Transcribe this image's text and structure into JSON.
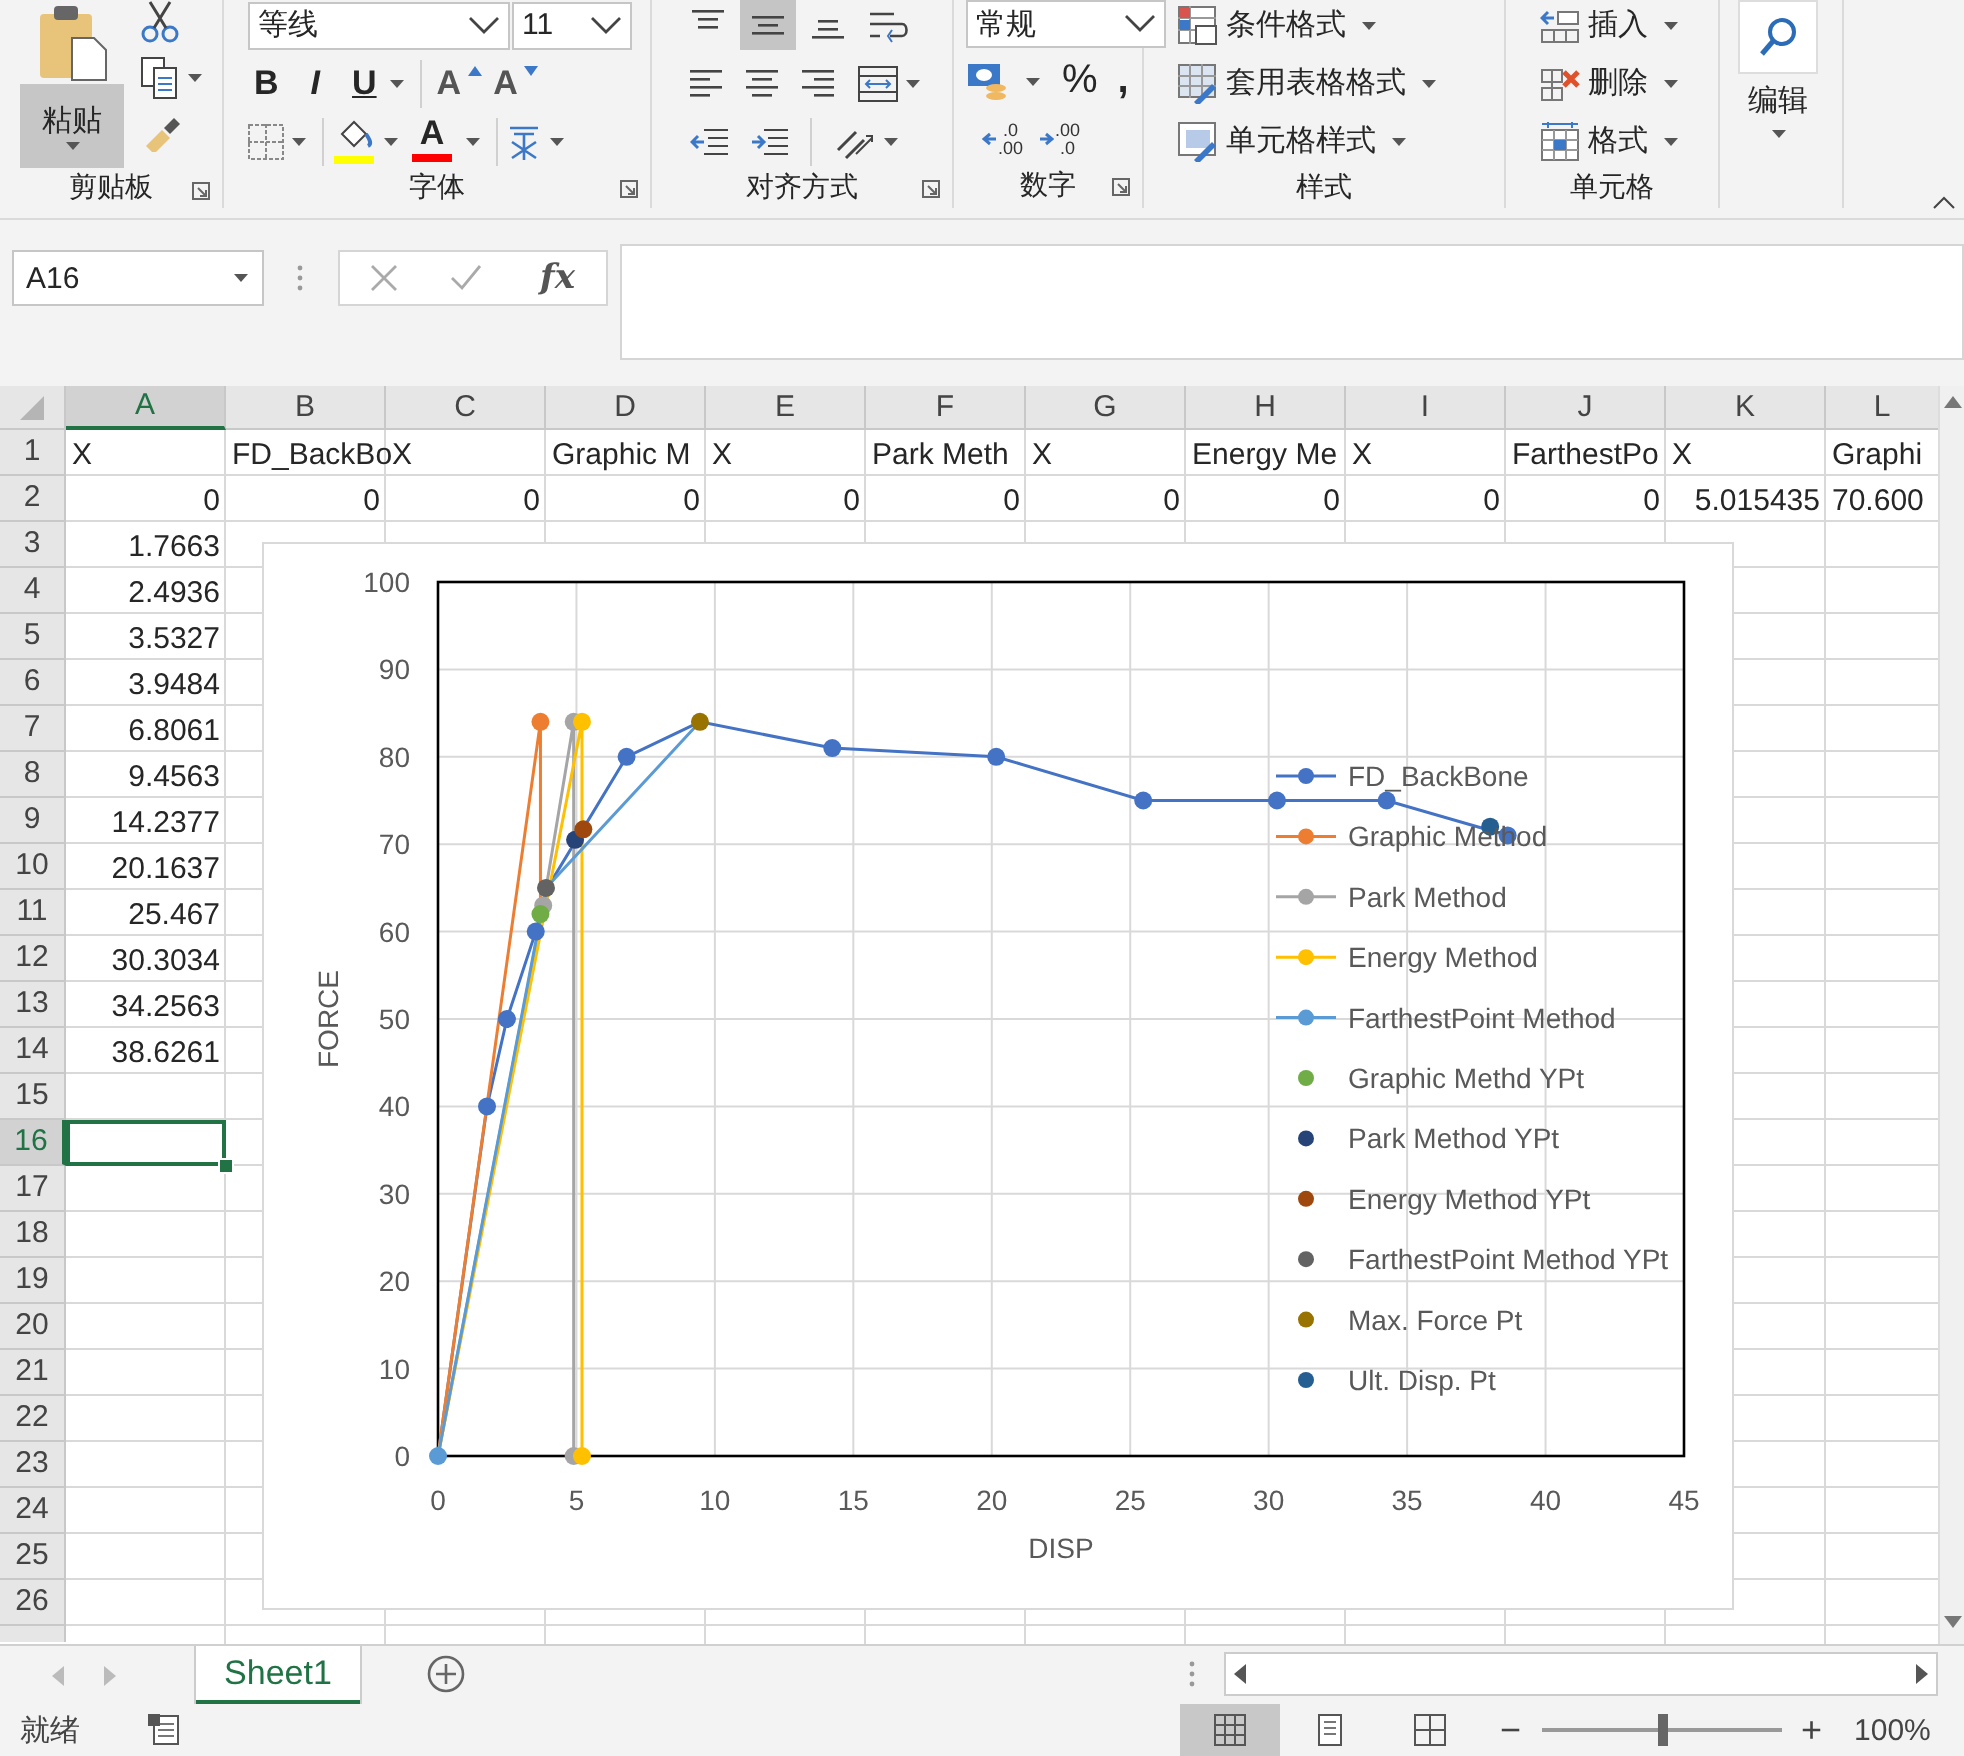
{
  "ribbon": {
    "groups": [
      {
        "kind": "clipboard",
        "label": "剪贴板",
        "launcher": true,
        "paste": "粘贴"
      },
      {
        "kind": "font",
        "label": "字体",
        "launcher": true,
        "family": "等线",
        "size": "11",
        "bold": "B",
        "italic": "I",
        "underline": "U",
        "grow": "A",
        "shrink": "A",
        "font_color": "A"
      },
      {
        "kind": "alignment",
        "label": "对齐方式",
        "launcher": true,
        "vertical": [
          {
            "kind": "top",
            "selected": false
          },
          {
            "kind": "middle",
            "selected": true
          },
          {
            "kind": "bottom",
            "selected": false
          }
        ]
      },
      {
        "kind": "number",
        "label": "数字",
        "launcher": true,
        "format": "常规",
        "percent": "%",
        "comma": ",",
        "decimals": [
          {
            "top": ".0",
            "bottom": ".00"
          },
          {
            "top": ".00",
            "bottom": ".0"
          }
        ]
      },
      {
        "kind": "styles",
        "label": "样式",
        "items": [
          "条件格式",
          "套用表格格式",
          "单元格样式"
        ]
      },
      {
        "kind": "cells",
        "label": "单元格",
        "items": [
          "插入",
          "删除",
          "格式"
        ]
      },
      {
        "kind": "editing",
        "label": "编辑"
      }
    ]
  },
  "formula_bar": {
    "name_box": "A16",
    "fx": "fx"
  },
  "sheet": {
    "columns": [
      {
        "label": "A",
        "selected": true
      },
      {
        "label": "B",
        "selected": false
      },
      {
        "label": "C",
        "selected": false
      },
      {
        "label": "D",
        "selected": false
      },
      {
        "label": "E",
        "selected": false
      },
      {
        "label": "F",
        "selected": false
      },
      {
        "label": "G",
        "selected": false
      },
      {
        "label": "H",
        "selected": false
      },
      {
        "label": "I",
        "selected": false
      },
      {
        "label": "J",
        "selected": false
      },
      {
        "label": "K",
        "selected": false
      },
      {
        "label": "L",
        "selected": false
      }
    ],
    "rows": [
      {
        "header": "1",
        "selected": false,
        "cells": [
          {
            "text": "X",
            "kind": "text"
          },
          {
            "text": "FD_BackBo",
            "kind": "text"
          },
          {
            "text": "X",
            "kind": "text"
          },
          {
            "text": "Graphic M",
            "kind": "text"
          },
          {
            "text": "X",
            "kind": "text"
          },
          {
            "text": "Park Meth",
            "kind": "text"
          },
          {
            "text": "X",
            "kind": "text"
          },
          {
            "text": "Energy Me",
            "kind": "text"
          },
          {
            "text": "X",
            "kind": "text"
          },
          {
            "text": "FarthestPo",
            "kind": "text"
          },
          {
            "text": "X",
            "kind": "text"
          },
          {
            "text": "Graphi",
            "kind": "text"
          }
        ]
      },
      {
        "header": "2",
        "selected": false,
        "cells": [
          {
            "text": "0",
            "kind": "number"
          },
          {
            "text": "0",
            "kind": "number"
          },
          {
            "text": "0",
            "kind": "number"
          },
          {
            "text": "0",
            "kind": "number"
          },
          {
            "text": "0",
            "kind": "number"
          },
          {
            "text": "0",
            "kind": "number"
          },
          {
            "text": "0",
            "kind": "number"
          },
          {
            "text": "0",
            "kind": "number"
          },
          {
            "text": "0",
            "kind": "number"
          },
          {
            "text": "0",
            "kind": "number"
          },
          {
            "text": "5.015435",
            "kind": "number"
          },
          {
            "text": "70.600",
            "kind": "text"
          }
        ]
      },
      {
        "header": "3",
        "selected": false,
        "cells": [
          {
            "text": "1.7663",
            "kind": "number"
          }
        ]
      },
      {
        "header": "4",
        "selected": false,
        "cells": [
          {
            "text": "2.4936",
            "kind": "number"
          }
        ]
      },
      {
        "header": "5",
        "selected": false,
        "cells": [
          {
            "text": "3.5327",
            "kind": "number"
          }
        ]
      },
      {
        "header": "6",
        "selected": false,
        "cells": [
          {
            "text": "3.9484",
            "kind": "number"
          }
        ]
      },
      {
        "header": "7",
        "selected": false,
        "cells": [
          {
            "text": "6.8061",
            "kind": "number"
          }
        ]
      },
      {
        "header": "8",
        "selected": false,
        "cells": [
          {
            "text": "9.4563",
            "kind": "number"
          }
        ]
      },
      {
        "header": "9",
        "selected": false,
        "cells": [
          {
            "text": "14.2377",
            "kind": "number"
          }
        ]
      },
      {
        "header": "10",
        "selected": false,
        "cells": [
          {
            "text": "20.1637",
            "kind": "number"
          }
        ]
      },
      {
        "header": "11",
        "selected": false,
        "cells": [
          {
            "text": "25.467",
            "kind": "number"
          }
        ]
      },
      {
        "header": "12",
        "selected": false,
        "cells": [
          {
            "text": "30.3034",
            "kind": "number"
          }
        ]
      },
      {
        "header": "13",
        "selected": false,
        "cells": [
          {
            "text": "34.2563",
            "kind": "number"
          }
        ]
      },
      {
        "header": "14",
        "selected": false,
        "cells": [
          {
            "text": "38.6261",
            "kind": "number"
          }
        ]
      },
      {
        "header": "15",
        "selected": false,
        "cells": []
      },
      {
        "header": "16",
        "selected": true,
        "cells": []
      },
      {
        "header": "17",
        "selected": false,
        "cells": []
      },
      {
        "header": "18",
        "selected": false,
        "cells": []
      },
      {
        "header": "19",
        "selected": false,
        "cells": []
      },
      {
        "header": "20",
        "selected": false,
        "cells": []
      },
      {
        "header": "21",
        "selected": false,
        "cells": []
      },
      {
        "header": "22",
        "selected": false,
        "cells": []
      },
      {
        "header": "23",
        "selected": false,
        "cells": []
      },
      {
        "header": "24",
        "selected": false,
        "cells": []
      },
      {
        "header": "25",
        "selected": false,
        "cells": []
      },
      {
        "header": "26",
        "selected": false,
        "cells": []
      }
    ],
    "chart": {
      "chart_data": {
        "type": "scatter",
        "xlabel": "DISP",
        "ylabel": "FORCE",
        "xlim": [
          0,
          45
        ],
        "ylim": [
          0,
          100
        ],
        "xticks": [
          0,
          5,
          10,
          15,
          20,
          25,
          30,
          35,
          40,
          45
        ],
        "yticks": [
          0,
          10,
          20,
          30,
          40,
          50,
          60,
          70,
          80,
          90,
          100
        ],
        "grid": true,
        "legend": true,
        "series": [
          {
            "name": "FD_BackBone",
            "color": "#4472c4",
            "type": "line",
            "x": [
              0,
              1.77,
              2.49,
              3.53,
              3.95,
              6.81,
              9.46,
              14.24,
              20.16,
              25.47,
              30.3,
              34.26,
              38.63
            ],
            "values": [
              0,
              40,
              50,
              60,
              65,
              80,
              84,
              81,
              80,
              75,
              75,
              75,
              71
            ]
          },
          {
            "name": "Graphic Method",
            "color": "#ed7d31",
            "type": "line",
            "x": [
              0,
              3.7,
              3.7
            ],
            "values": [
              0,
              84,
              62
            ]
          },
          {
            "name": "Park Method",
            "color": "#a5a5a5",
            "type": "line",
            "x": [
              0,
              3.8,
              4.9,
              4.9
            ],
            "values": [
              0,
              63,
              84,
              0
            ]
          },
          {
            "name": "Energy Method",
            "color": "#ffc000",
            "type": "line",
            "x": [
              0,
              5.2,
              5.2
            ],
            "values": [
              0,
              84,
              0
            ]
          },
          {
            "name": "FarthestPoint Method",
            "color": "#5b9bd5",
            "type": "line",
            "x": [
              0,
              3.9,
              9.46
            ],
            "values": [
              0,
              65,
              84
            ]
          },
          {
            "name": "Graphic Methd YPt",
            "color": "#70ad47",
            "type": "scatter",
            "x": [
              3.7
            ],
            "values": [
              62
            ]
          },
          {
            "name": "Park Method YPt",
            "color": "#264478",
            "type": "scatter",
            "x": [
              4.95
            ],
            "values": [
              70.5
            ]
          },
          {
            "name": "Energy Method YPt",
            "color": "#9e480e",
            "type": "scatter",
            "x": [
              5.25
            ],
            "values": [
              71.7
            ]
          },
          {
            "name": "FarthestPoint Method YPt",
            "color": "#636363",
            "type": "scatter",
            "x": [
              3.9
            ],
            "values": [
              65
            ]
          },
          {
            "name": "Max. Force Pt",
            "color": "#997300",
            "type": "scatter",
            "x": [
              9.46
            ],
            "values": [
              84
            ]
          },
          {
            "name": "Ult. Disp. Pt",
            "color": "#255e91",
            "type": "scatter",
            "x": [
              38
            ],
            "values": [
              72
            ]
          }
        ]
      }
    }
  },
  "sheet_tabs": [
    {
      "label": "Sheet1",
      "selected": true
    }
  ],
  "status_bar": {
    "status": "就绪",
    "views": [
      {
        "kind": "normal",
        "selected": true
      },
      {
        "kind": "page_layout",
        "selected": false
      },
      {
        "kind": "page_break",
        "selected": false
      }
    ],
    "zoom_out": "−",
    "zoom_in": "+",
    "zoom_slider": {
      "level": 0.5
    },
    "zoom": "100%"
  }
}
